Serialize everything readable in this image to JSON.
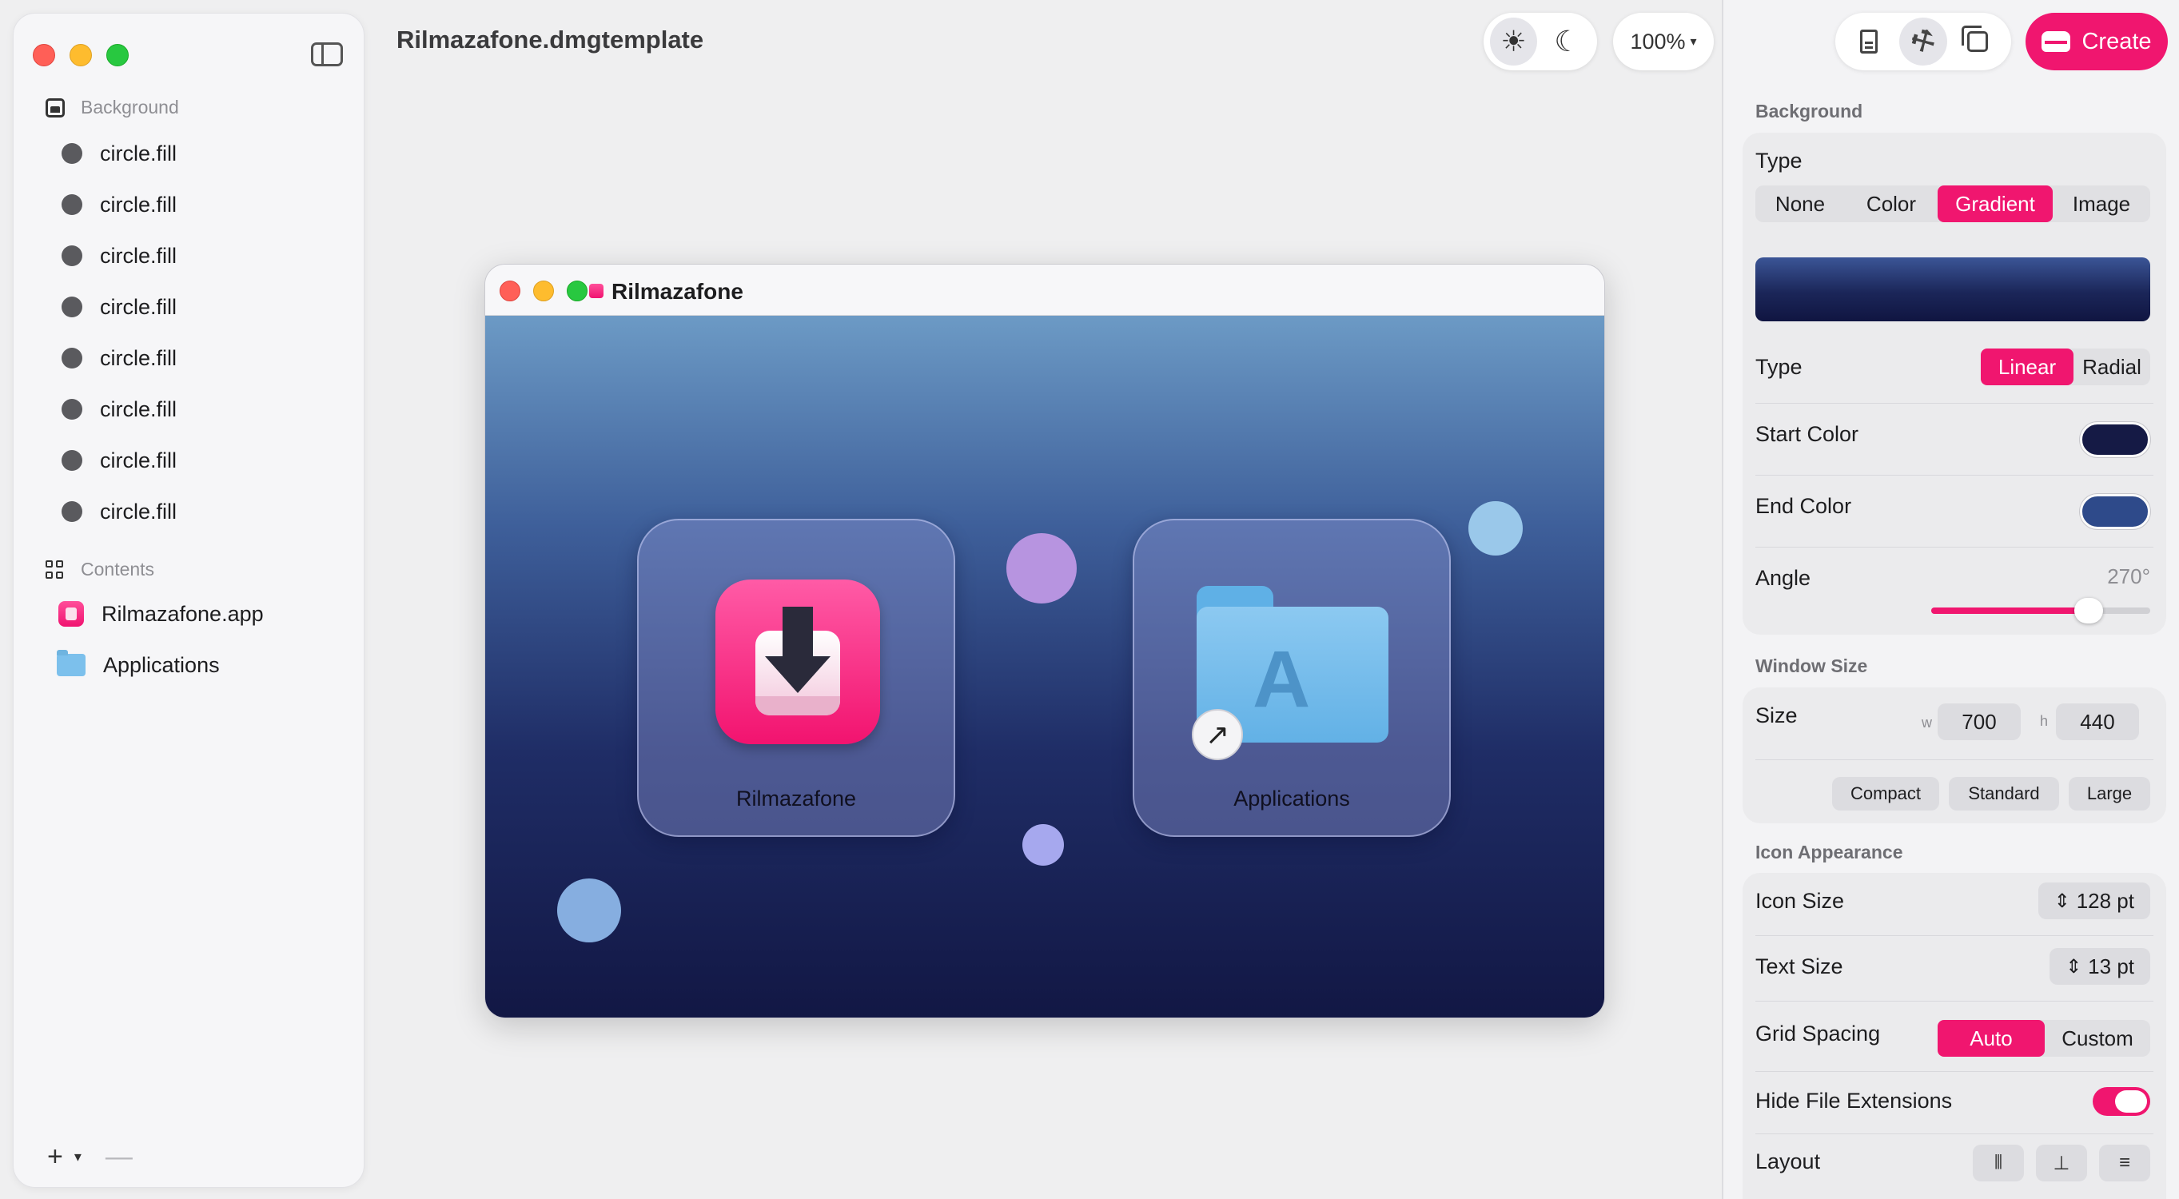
{
  "sidebar": {
    "background_header": "Background",
    "background_items": [
      "circle.fill",
      "circle.fill",
      "circle.fill",
      "circle.fill",
      "circle.fill",
      "circle.fill",
      "circle.fill",
      "circle.fill"
    ],
    "contents_header": "Contents",
    "contents_items": [
      "Rilmazafone.app",
      "Applications"
    ],
    "add_label": "+",
    "remove_label": "—"
  },
  "toolbar": {
    "document_title": "Rilmazafone.dmgtemplate",
    "light_icon": "☀",
    "dark_icon": "☾",
    "zoom": "100%"
  },
  "preview": {
    "window_title": "Rilmazafone",
    "icons": [
      {
        "label": "Rilmazafone",
        "icon": "dmg-app-icon"
      },
      {
        "label": "Applications",
        "icon": "applications-folder-icon"
      }
    ],
    "alias_arrow": "↗",
    "folder_glyph": "A",
    "bubble_colors": [
      "#9ac8ea",
      "#b794e0",
      "#a6a8ee",
      "#86aee0"
    ]
  },
  "inspector": {
    "create_label": "Create",
    "background": {
      "title": "Background",
      "type_label": "Type",
      "type_options": [
        "None",
        "Color",
        "Gradient",
        "Image"
      ],
      "type_selected": "Gradient",
      "gradient_type_label": "Type",
      "gradient_type_options": [
        "Linear",
        "Radial"
      ],
      "gradient_type_selected": "Linear",
      "start_color_label": "Start Color",
      "start_color": "#151a45",
      "end_color_label": "End Color",
      "end_color": "#2e4a8a",
      "angle_label": "Angle",
      "angle_value": "270°",
      "angle_fraction": 0.75
    },
    "window_size": {
      "title": "Window Size",
      "size_label": "Size",
      "w_label": "w",
      "w_value": "700",
      "h_label": "h",
      "h_value": "440",
      "presets": [
        "Compact",
        "Standard",
        "Large"
      ]
    },
    "icon_appearance": {
      "title": "Icon Appearance",
      "icon_size_label": "Icon Size",
      "icon_size_value": "128 pt",
      "text_size_label": "Text Size",
      "text_size_value": "13 pt",
      "grid_spacing_label": "Grid Spacing",
      "grid_spacing_options": [
        "Auto",
        "Custom"
      ],
      "grid_spacing_selected": "Auto",
      "hide_ext_label": "Hide File Extensions",
      "hide_ext_on": true,
      "layout_label": "Layout",
      "stepper_glyph": "⇕",
      "layout_icons": [
        "distribute-horizontal-icon",
        "align-center-icon",
        "distribute-vertical-icon"
      ]
    },
    "accent_color": "#f0166f"
  }
}
